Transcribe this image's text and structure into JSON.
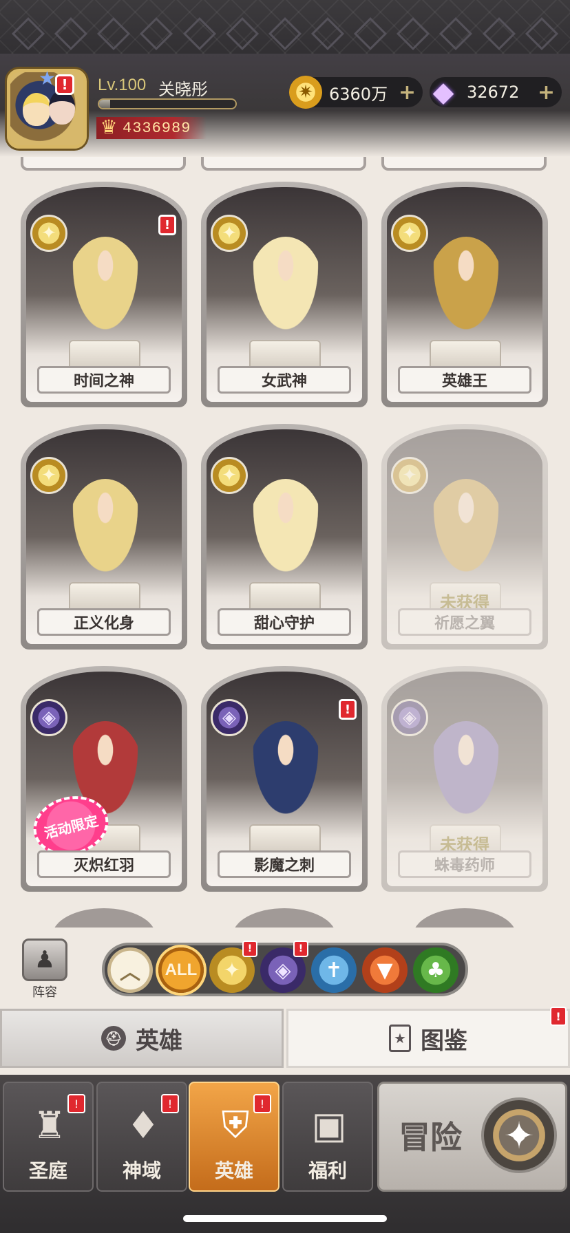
{
  "player": {
    "level_label": "Lv.100",
    "name": "关晓彤",
    "power": "4336989",
    "xp_fraction": 0.08
  },
  "currency": {
    "gold": "6360万",
    "gems": "32672",
    "gold_icon": "gold-coin-icon",
    "gem_icon": "diamond-icon"
  },
  "heroes": [
    {
      "name": "时间之神",
      "class": "light",
      "obtained": true,
      "alert": true,
      "limited": false
    },
    {
      "name": "女武神",
      "class": "light",
      "obtained": true,
      "alert": false,
      "limited": false
    },
    {
      "name": "英雄王",
      "class": "light",
      "obtained": true,
      "alert": false,
      "limited": false
    },
    {
      "name": "正义化身",
      "class": "light",
      "obtained": true,
      "alert": false,
      "limited": false
    },
    {
      "name": "甜心守护",
      "class": "light",
      "obtained": true,
      "alert": false,
      "limited": false
    },
    {
      "name": "祈愿之翼",
      "class": "light",
      "obtained": false,
      "alert": false,
      "limited": false
    },
    {
      "name": "灭炽红羽",
      "class": "dark",
      "obtained": true,
      "alert": false,
      "limited": true
    },
    {
      "name": "影魔之刺",
      "class": "dark",
      "obtained": true,
      "alert": true,
      "limited": false
    },
    {
      "name": "蛛毒药师",
      "class": "dark",
      "obtained": false,
      "alert": false,
      "limited": false
    }
  ],
  "labels": {
    "unobtained": "未获得",
    "limited": "活动限定",
    "lineup": "阵容",
    "all": "ALL",
    "alert": "!"
  },
  "filters": [
    {
      "name": "collapse",
      "icon": "chevron-up-icon",
      "alert": false
    },
    {
      "name": "all",
      "icon": "all-icon",
      "alert": false,
      "active": true
    },
    {
      "name": "light",
      "icon": "light-faction-icon",
      "alert": true
    },
    {
      "name": "dark",
      "icon": "dark-faction-icon",
      "alert": true
    },
    {
      "name": "holy",
      "icon": "sword-faction-icon",
      "alert": false
    },
    {
      "name": "beast",
      "icon": "wolf-faction-icon",
      "alert": false
    },
    {
      "name": "nature",
      "icon": "tree-faction-icon",
      "alert": false
    }
  ],
  "tabs": {
    "heroes": "英雄",
    "atlas": "图鉴"
  },
  "nav": {
    "court": "圣庭",
    "divine": "神域",
    "heroes": "英雄",
    "welfare": "福利",
    "adventure": "冒险"
  },
  "colors": {
    "alert": "#e0282f",
    "active_nav": "#e38a2e",
    "light_faction": "#d9a92a",
    "dark_faction": "#4b3886"
  }
}
